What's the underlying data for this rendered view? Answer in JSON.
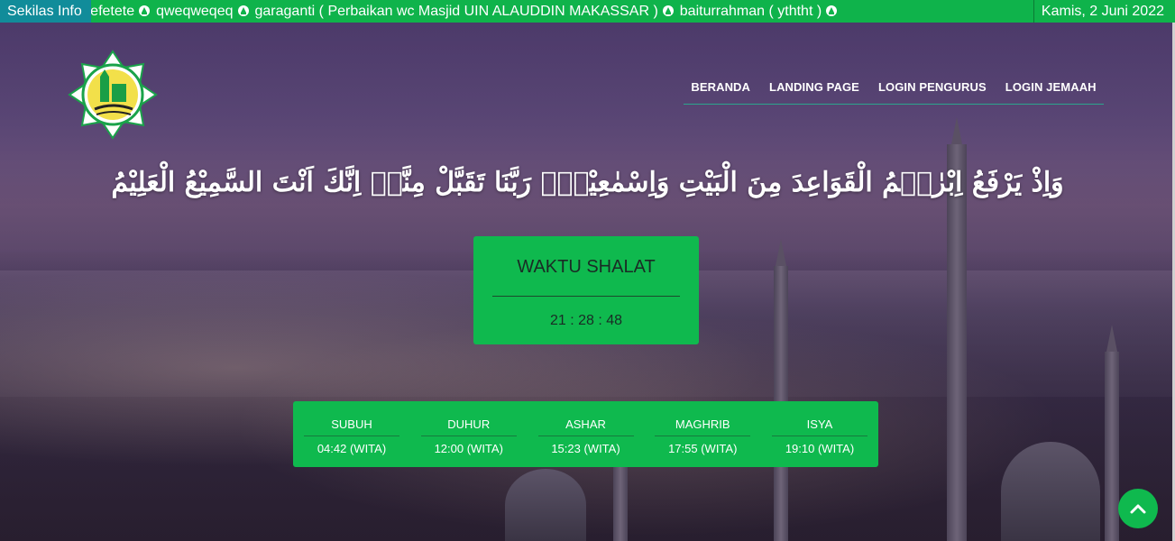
{
  "topbar": {
    "label": "Sekilas Info",
    "ticker_items": [
      "tefetete",
      "qweqweqeq",
      "garaganti ( Perbaikan wc Masjid UIN ALAUDDIN MAKASSAR )",
      "baiturrahman ( yththt )"
    ],
    "date": "Kamis, 2 Juni 2022"
  },
  "nav": {
    "items": [
      "BERANDA",
      "LANDING PAGE",
      "LOGIN PENGURUS",
      "LOGIN JEMAAH"
    ]
  },
  "verse": "وَاِذْ يَرْفَعُ اِبْرٰهٖمُ الْقَوَاعِدَ مِنَ الْبَيْتِ وَاِسْمٰعِيْلُۗ رَبَّنَا تَقَبَّلْ مِنَّاۗ اِنَّكَ اَنْتَ السَّمِيْعُ الْعَلِيْمُ",
  "clock": {
    "title": "WAKTU SHALAT",
    "time": "21 : 28 : 48"
  },
  "prayers": [
    {
      "name": "SUBUH",
      "time": "04:42 (WITA)"
    },
    {
      "name": "DUHUR",
      "time": "12:00 (WITA)"
    },
    {
      "name": "ASHAR",
      "time": "15:23 (WITA)"
    },
    {
      "name": "MAGHRIB",
      "time": "17:55 (WITA)"
    },
    {
      "name": "ISYA",
      "time": "19:10 (WITA)"
    }
  ],
  "colors": {
    "brand_green": "#0fb94e",
    "ticker_label": "#118c9a"
  }
}
